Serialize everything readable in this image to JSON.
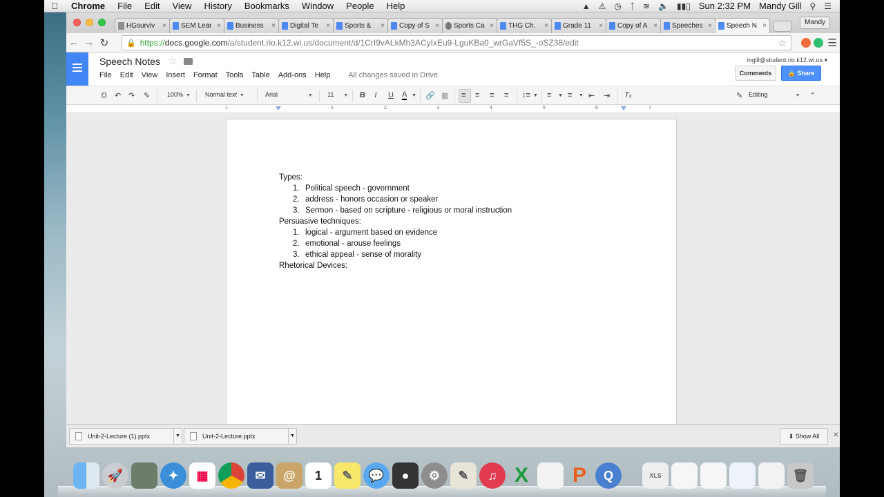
{
  "menubar": {
    "app": "Chrome",
    "items": [
      "File",
      "Edit",
      "View",
      "History",
      "Bookmarks",
      "Window",
      "People",
      "Help"
    ],
    "clock": "Sun 2:32 PM",
    "user": "Mandy Gill"
  },
  "tabs": [
    {
      "label": "HGsurviv"
    },
    {
      "label": "SEM Lear"
    },
    {
      "label": "Business"
    },
    {
      "label": "Digital Te"
    },
    {
      "label": "Sports &"
    },
    {
      "label": "Copy of S"
    },
    {
      "label": "Sports Ca"
    },
    {
      "label": "THG Ch."
    },
    {
      "label": "Grade 11"
    },
    {
      "label": "Copy of A"
    },
    {
      "label": "Speeches"
    },
    {
      "label": "Speech N"
    }
  ],
  "profile": "Mandy",
  "url": {
    "scheme": "https://",
    "host": "docs.google.com",
    "path": "/a/student.rio.k12.wi.us/document/d/1CrI9vALkMh3ACyIxEu9-LguKBa0_wrGaVf5S_-oSZ38/edit"
  },
  "doc": {
    "title": "Speech Notes",
    "menu": [
      "File",
      "Edit",
      "View",
      "Insert",
      "Format",
      "Tools",
      "Table",
      "Add-ons",
      "Help"
    ],
    "saved_status": "All changes saved in Drive",
    "account": "mgill@student.rio.k12.wi.us",
    "comments_label": "Comments",
    "share_label": "Share"
  },
  "format": {
    "zoom": "100%",
    "style": "Normal text",
    "font": "Arial",
    "size": "11",
    "mode": "Editing"
  },
  "ruler": [
    "1",
    "1",
    "2",
    "3",
    "4",
    "5",
    "6",
    "7"
  ],
  "content": {
    "types_heading": "Types:",
    "types": [
      {
        "n": "1.",
        "text": "Political speech - government"
      },
      {
        "n": "2.",
        "text": "address - honors occasion or speaker"
      },
      {
        "n": "3.",
        "text": "Sermon - based on scripture - religious or moral instruction"
      }
    ],
    "persuasive_heading": "Persuasive techniques:",
    "persuasive": [
      {
        "n": "1.",
        "text": "logical - argument based on evidence"
      },
      {
        "n": "2.",
        "text": "emotional - arouse feelings"
      },
      {
        "n": "3.",
        "text": "ethical appeal - sense of morality"
      }
    ],
    "rhetorical_heading": "Rhetorical Devices:"
  },
  "downloads": [
    {
      "name": "Unit-2-Lecture (1).pptx"
    },
    {
      "name": "Unit-2-Lecture.pptx"
    }
  ],
  "show_all": "Show All",
  "colors": {
    "docs_blue": "#4285f4",
    "share_blue": "#4d90fe",
    "https_green": "#2a9d2a"
  }
}
